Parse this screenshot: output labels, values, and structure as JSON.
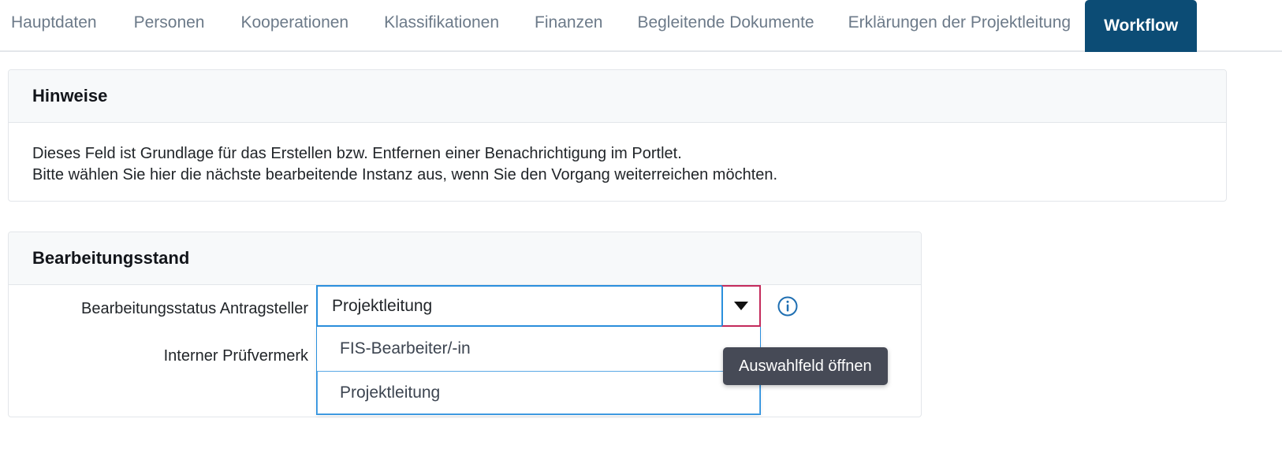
{
  "tabs": [
    {
      "label": "Hauptdaten",
      "active": false
    },
    {
      "label": "Personen",
      "active": false
    },
    {
      "label": "Kooperationen",
      "active": false
    },
    {
      "label": "Klassifikationen",
      "active": false
    },
    {
      "label": "Finanzen",
      "active": false
    },
    {
      "label": "Begleitende Dokumente",
      "active": false
    },
    {
      "label": "Erklärungen der Projektleitung",
      "active": false
    },
    {
      "label": "Workflow",
      "active": true
    }
  ],
  "hinweise": {
    "title": "Hinweise",
    "body": "Dieses Feld ist Grundlage für das Erstellen bzw. Entfernen einer Benachrichtigung im Portlet.\nBitte wählen Sie hier die nächste bearbeitende Instanz aus, wenn Sie den Vorgang weiterreichen möchten."
  },
  "bearbeitungsstand": {
    "title": "Bearbeitungsstand",
    "fields": [
      {
        "label": "Bearbeitungsstatus Antragsteller",
        "value": "Projektleitung",
        "placeholder": ""
      },
      {
        "label": "Interner Prüfvermerk",
        "value": "",
        "placeholder": ""
      }
    ],
    "dropdown": {
      "open": true,
      "options": [
        {
          "label": "FIS-Bearbeiter/-in",
          "highlighted": false
        },
        {
          "label": "Projektleitung",
          "highlighted": true
        }
      ]
    },
    "info_icon": "info-circle-icon",
    "dropdown_button_icon": "chevron-down-icon"
  },
  "tooltip": {
    "text": "Auswahlfeld öffnen"
  },
  "colors": {
    "active_tab_bg": "#0c4c75",
    "focus_border": "#2a8fdd",
    "button_border": "#c42b5c",
    "info_icon": "#1f6fb2",
    "tooltip_bg": "#464a56",
    "panel_header_bg": "#f7f9fa",
    "panel_border": "#e3e6ea",
    "tab_text": "#6c7a89"
  }
}
